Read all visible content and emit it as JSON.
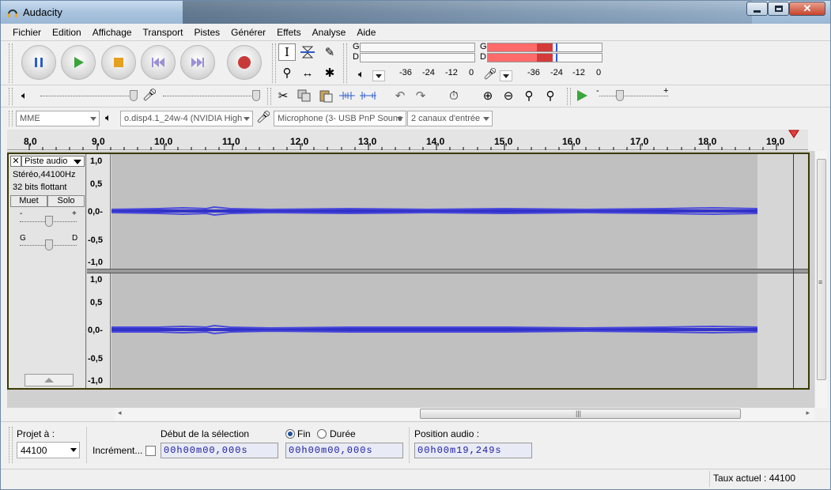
{
  "window": {
    "title": "Audacity"
  },
  "menu": [
    "Fichier",
    "Edition",
    "Affichage",
    "Transport",
    "Pistes",
    "Générer",
    "Effets",
    "Analyse",
    "Aide"
  ],
  "meters": {
    "play_g": "G",
    "play_d": "D",
    "rec_g": "G",
    "rec_d": "D",
    "ticks": [
      "-36",
      "-24",
      "-12",
      "0"
    ],
    "rec_ticks": [
      "-36",
      "-24",
      "-12",
      "0"
    ]
  },
  "device": {
    "host": "MME",
    "output": "o.disp4.1_24w-4 (NVIDIA High",
    "input": "Microphone (3- USB PnP Sounc",
    "channels": "2 canaux d'entrée"
  },
  "ruler": [
    "8,0",
    "9,0",
    "10,0",
    "11,0",
    "12,0",
    "13,0",
    "14,0",
    "15,0",
    "16,0",
    "17,0",
    "18,0",
    "19,0"
  ],
  "track": {
    "name": "Piste audio",
    "info1": "Stéréo,44100Hz",
    "info2": "32 bits flottant",
    "mute": "Muet",
    "solo": "Solo",
    "gain_minus": "-",
    "gain_plus": "+",
    "pan_left": "G",
    "pan_right": "D",
    "scale": [
      "1,0",
      "0,5",
      "0,0-",
      "-0,5",
      "-1,0"
    ]
  },
  "bottom": {
    "project_rate_label": "Projet à :",
    "project_rate": "44100",
    "snap_label": "Incrément...",
    "sel_start_label": "Début de la sélection",
    "end_label": "Fin",
    "length_label": "Durée",
    "audio_pos_label": "Position audio :",
    "sel_start": "00h00m00,000s",
    "sel_end": "00h00m00,000s",
    "audio_pos": "00h00m19,249s",
    "status": "Taux actuel : 44100"
  },
  "colors": {
    "wave": "#3232c8",
    "accent": "#d4d000",
    "meter_red": "#ff6666"
  }
}
